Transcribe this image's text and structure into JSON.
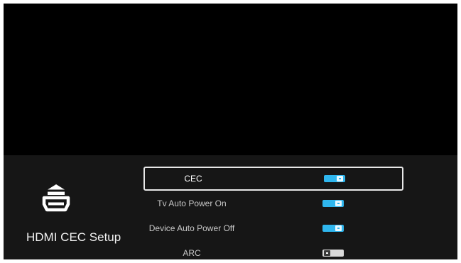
{
  "section": {
    "icon": "hdmi-port-icon",
    "title": "HDMI CEC Setup"
  },
  "options": [
    {
      "label": "CEC",
      "enabled": true,
      "focused": true
    },
    {
      "label": "Tv Auto Power On",
      "enabled": true,
      "focused": false
    },
    {
      "label": "Device Auto Power Off",
      "enabled": true,
      "focused": false
    },
    {
      "label": "ARC",
      "enabled": false,
      "focused": false
    }
  ],
  "colors": {
    "screen_background": "#000000",
    "panel_background": "#161616",
    "toggle_on": "#2fb6ee",
    "toggle_off": "#d9d9d9",
    "focus_border": "#e8e8e8"
  }
}
